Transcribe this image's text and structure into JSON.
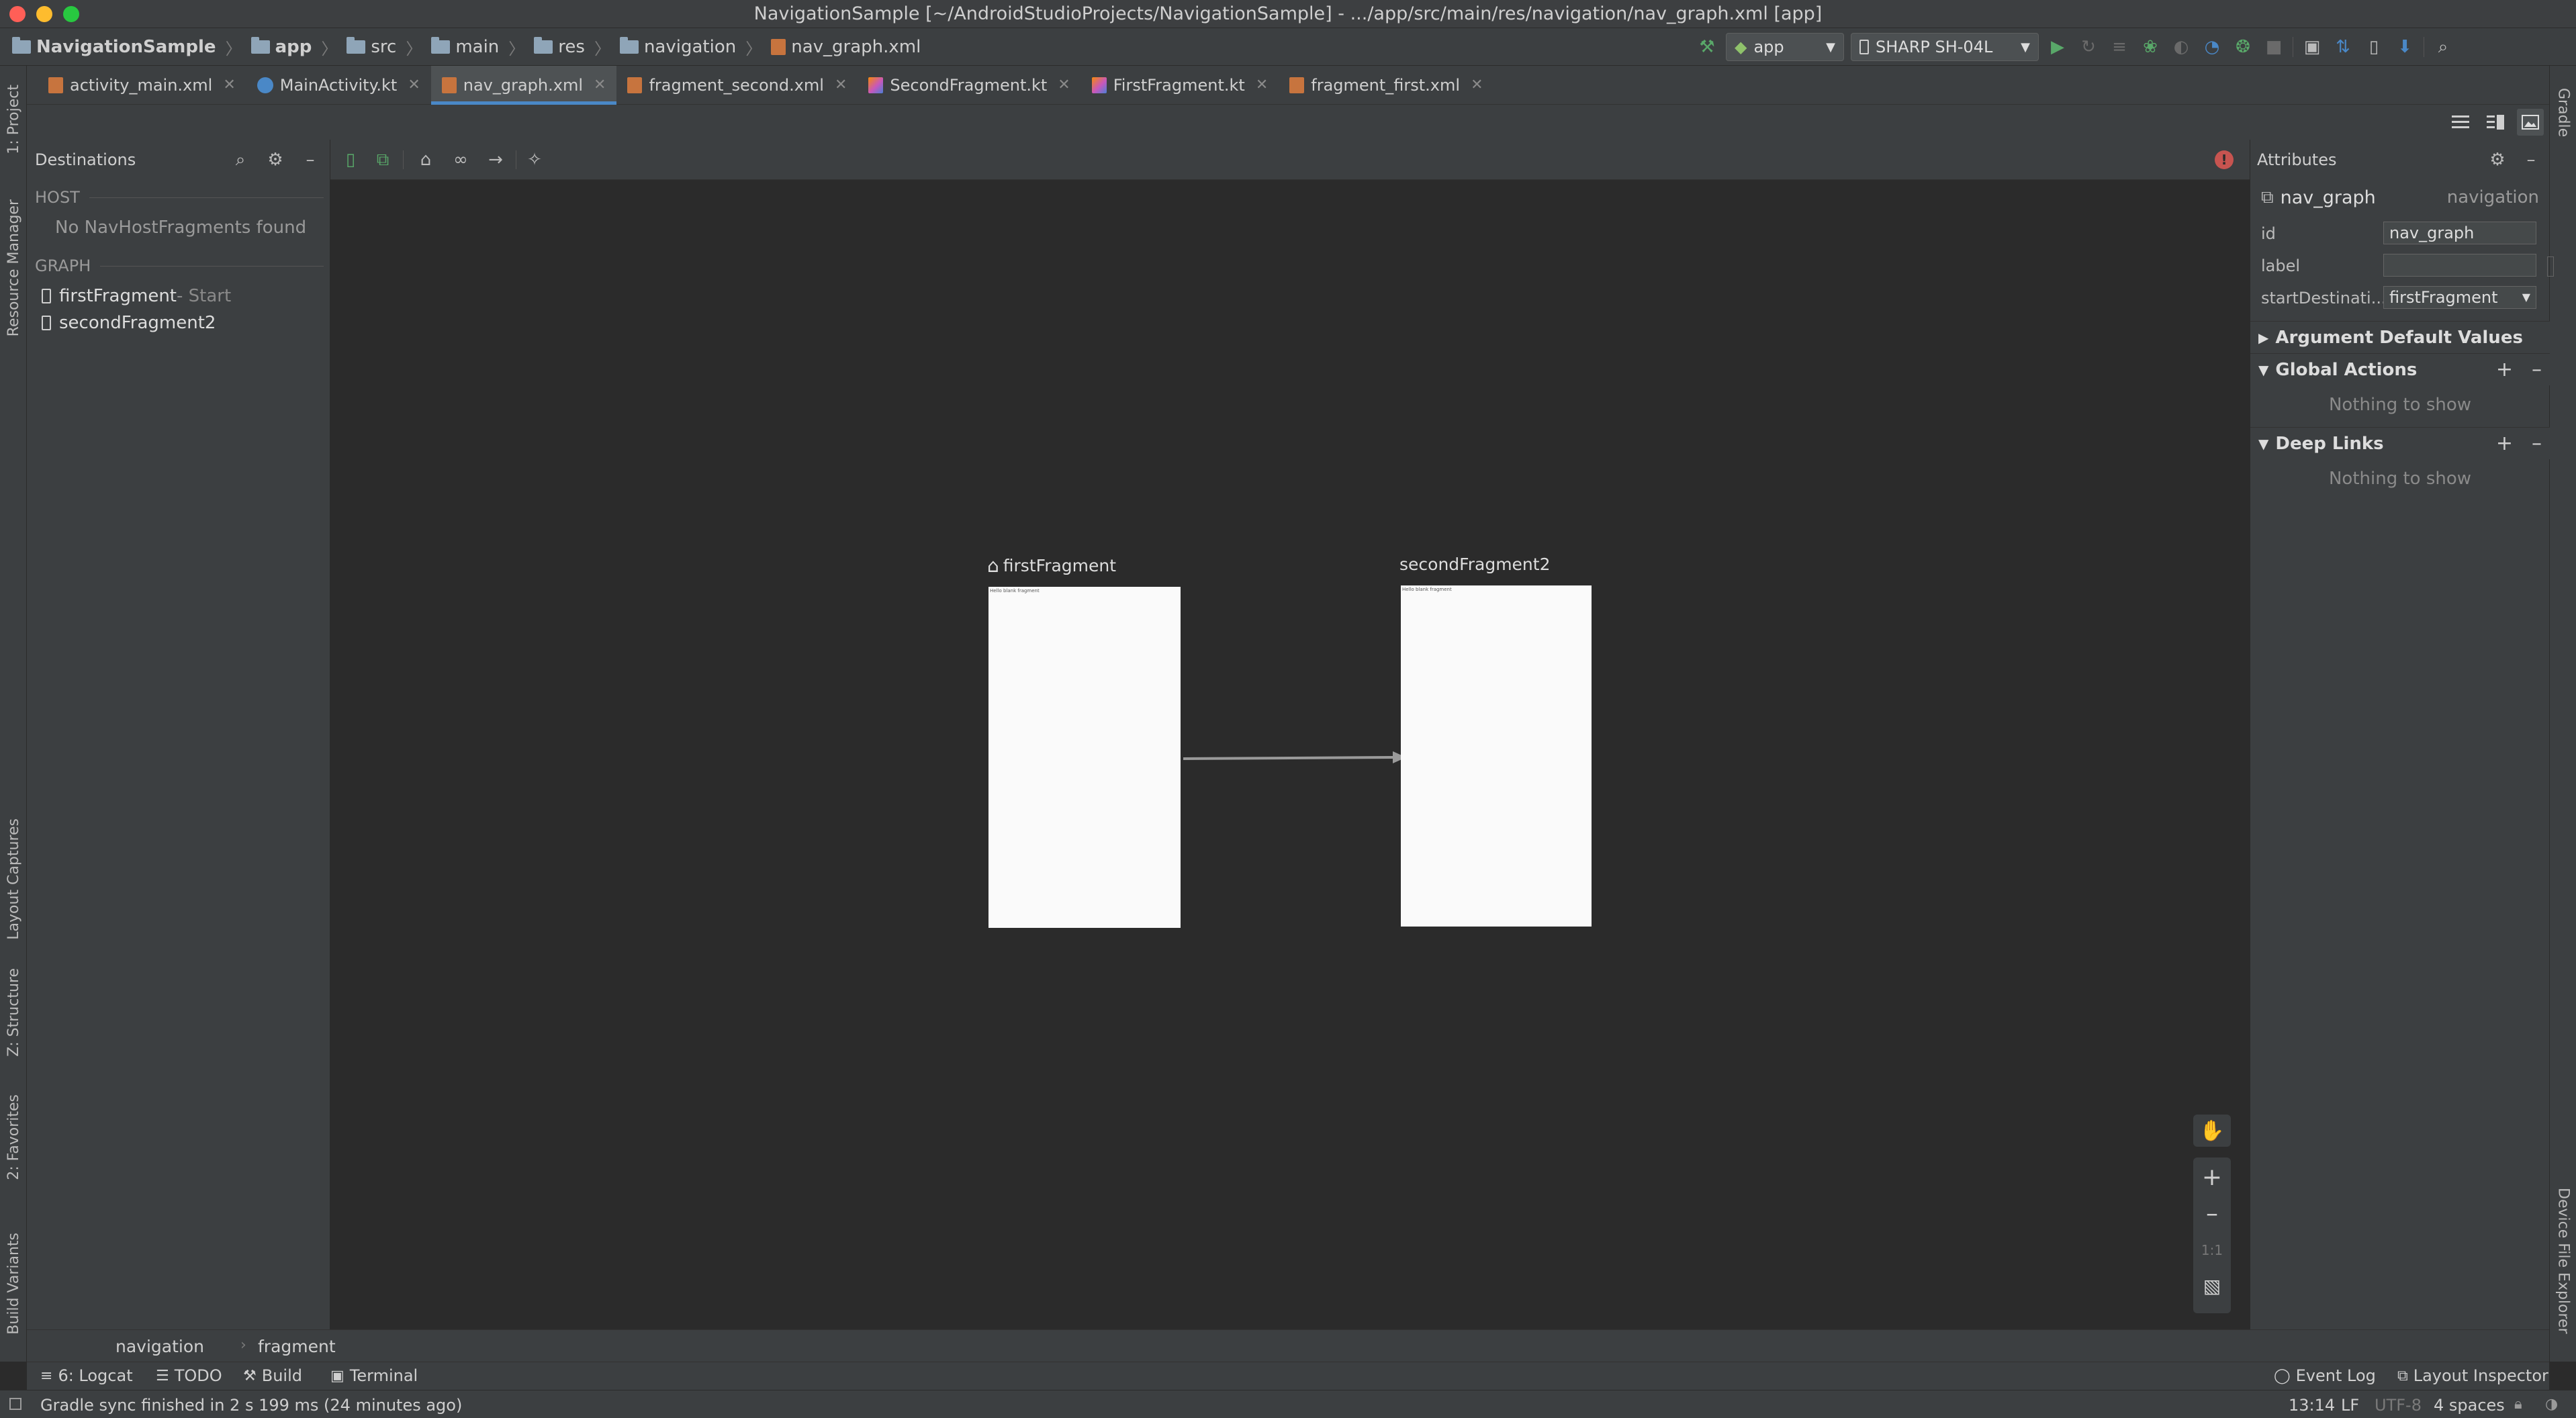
{
  "window": {
    "title": "NavigationSample [~/AndroidStudioProjects/NavigationSample] - .../app/src/main/res/navigation/nav_graph.xml [app]"
  },
  "navbar": {
    "crumbs": [
      "NavigationSample",
      "app",
      "src",
      "main",
      "res",
      "navigation",
      "nav_graph.xml"
    ],
    "run_config": "app",
    "device": "SHARP SH-04L"
  },
  "tabs": [
    {
      "label": "activity_main.xml",
      "type": "xml",
      "active": false
    },
    {
      "label": "MainActivity.kt",
      "type": "class",
      "active": false
    },
    {
      "label": "nav_graph.xml",
      "type": "xml",
      "active": true
    },
    {
      "label": "fragment_second.xml",
      "type": "xml",
      "active": false
    },
    {
      "label": "SecondFragment.kt",
      "type": "kotlin",
      "active": false
    },
    {
      "label": "FirstFragment.kt",
      "type": "kotlin",
      "active": false
    },
    {
      "label": "fragment_first.xml",
      "type": "xml",
      "active": false
    }
  ],
  "left_stripe": {
    "project": "1: Project",
    "resource_manager": "Resource Manager",
    "layout_captures": "Layout Captures",
    "structure": "Z: Structure",
    "favorites": "2: Favorites",
    "build_variants": "Build Variants"
  },
  "right_stripe": {
    "gradle": "Gradle",
    "device_file_explorer": "Device File Explorer"
  },
  "destinations": {
    "title": "Destinations",
    "host_header": "HOST",
    "host_empty": "No NavHostFragments found",
    "graph_header": "GRAPH",
    "items": [
      {
        "name": "firstFragment",
        "suffix": " - Start"
      },
      {
        "name": "secondFragment2",
        "suffix": ""
      }
    ]
  },
  "canvas": {
    "first": {
      "label": "firstFragment",
      "preview_text": "Hello blank fragment"
    },
    "second": {
      "label": "secondFragment2",
      "preview_text": "Hello blank fragment"
    },
    "zoom_one_to_one": "1:1"
  },
  "attributes": {
    "title": "Attributes",
    "element_name": "nav_graph",
    "element_type": "navigation",
    "fields": [
      {
        "label": "id",
        "value": "nav_graph"
      },
      {
        "label": "label",
        "value": ""
      },
      {
        "label": "startDestinati...",
        "value": "firstFragment"
      }
    ],
    "argument_defaults": "Argument Default Values",
    "global_actions": "Global Actions",
    "deep_links": "Deep Links",
    "nothing_to_show": "Nothing to show"
  },
  "bottom_breadcrumbs": [
    "navigation",
    "fragment"
  ],
  "tool_windows": {
    "logcat": "6: Logcat",
    "todo": "TODO",
    "build": "Build",
    "terminal": "Terminal",
    "event_log": "Event Log",
    "layout_inspector": "Layout Inspector"
  },
  "status": {
    "message": "Gradle sync finished in 2 s 199 ms (24 minutes ago)",
    "position": "13:14",
    "line_sep": "LF",
    "encoding": "UTF-8",
    "indent": "4 spaces"
  },
  "colors": {
    "accent": "#4a88c7",
    "run_green": "#59a869",
    "error_red": "#c75450",
    "xml_orange": "#c7743e"
  }
}
